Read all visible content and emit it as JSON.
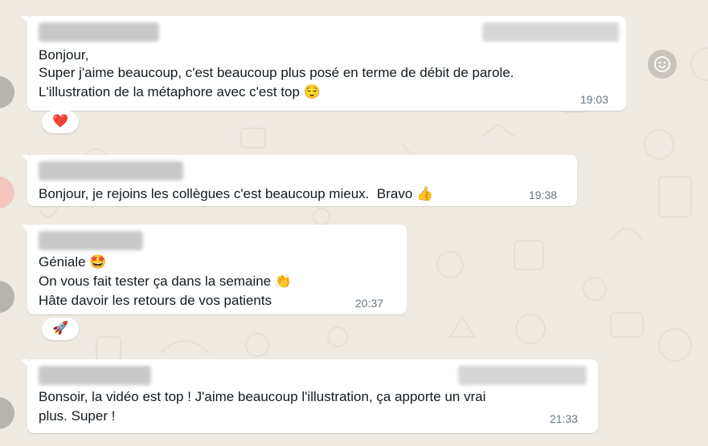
{
  "messages": [
    {
      "lines": [
        "Bonjour,",
        "Super j'aime beaucoup, c'est beaucoup plus posé en terme de débit de parole.",
        "L'illustration de la métaphore avec c'est top 😌"
      ],
      "time": "19:03",
      "reaction": "❤️"
    },
    {
      "lines": [
        "Bonjour, je rejoins les collègues c'est beaucoup mieux.  Bravo 👍"
      ],
      "time": "19:38"
    },
    {
      "lines": [
        "Géniale 🤩",
        "On vous fait tester ça dans la semaine 👏",
        "Hâte davoir les retours de vos patients"
      ],
      "time": "20:37",
      "reaction": "🚀"
    },
    {
      "lines": [
        "Bonsoir, la vidéo est top ! J'aime beaucoup l'illustration, ça apporte un vrai",
        "plus. Super !"
      ],
      "time": "21:33"
    }
  ],
  "icons": {
    "emoji_button": "smiley-icon"
  },
  "colors": {
    "background": "#efeae2",
    "bubble": "#ffffff",
    "text": "#111b21",
    "time": "#667781"
  }
}
